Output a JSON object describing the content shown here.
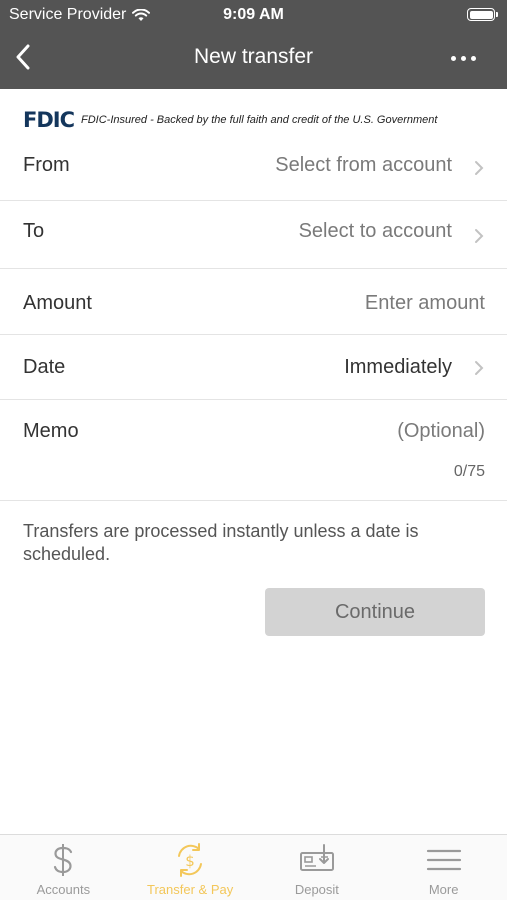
{
  "status_bar": {
    "carrier": "Service Provider",
    "time": "9:09 AM"
  },
  "nav": {
    "title": "New transfer"
  },
  "fdic": {
    "logo": "FDIC",
    "text": "FDIC-Insured - Backed by the full faith and credit of the U.S. Government"
  },
  "form": {
    "from": {
      "label": "From",
      "value": "Select from account"
    },
    "to": {
      "label": "To",
      "value": "Select to account"
    },
    "amount": {
      "label": "Amount",
      "placeholder": "Enter amount"
    },
    "date": {
      "label": "Date",
      "value": "Immediately"
    },
    "memo": {
      "label": "Memo",
      "placeholder": "(Optional)",
      "counter": "0/75"
    }
  },
  "info_text": "Transfers are processed instantly unless a date is scheduled.",
  "continue_label": "Continue",
  "tabbar": {
    "items": [
      {
        "label": "Accounts",
        "icon": "dollar-icon",
        "active": false
      },
      {
        "label": "Transfer & Pay",
        "icon": "transfer-pay-icon",
        "active": true
      },
      {
        "label": "Deposit",
        "icon": "deposit-check-icon",
        "active": false
      },
      {
        "label": "More",
        "icon": "menu-icon",
        "active": false
      }
    ]
  },
  "colors": {
    "header": "#545454",
    "accent": "#f3c75a",
    "fdic_blue": "#14365c",
    "button_disabled": "#d3d3d3"
  }
}
